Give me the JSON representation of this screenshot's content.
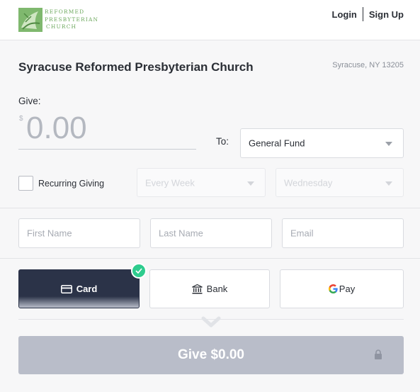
{
  "header": {
    "logo_lines": [
      "REFORMED",
      "PRESBYTERIAN",
      "CHURCH"
    ],
    "login_label": "Login",
    "signup_label": "Sign Up"
  },
  "church": {
    "name": "Syracuse Reformed Presbyterian Church",
    "location": "Syracuse, NY 13205"
  },
  "give": {
    "label": "Give:",
    "currency_symbol": "$",
    "amount_value": "0.00",
    "to_label": "To:",
    "fund_selected": "General Fund"
  },
  "recurring": {
    "label": "Recurring Giving",
    "checked": false,
    "frequency_selected": "Every Week",
    "day_selected": "Wednesday"
  },
  "donor": {
    "first_name_placeholder": "First Name",
    "last_name_placeholder": "Last Name",
    "email_placeholder": "Email"
  },
  "payment_methods": {
    "card_label": "Card",
    "bank_label": "Bank",
    "gpay_label": "Pay",
    "selected": "Card"
  },
  "submit": {
    "label": "Give $0.00"
  },
  "colors": {
    "accent_dark": "#2b3348",
    "success": "#2ecc8e",
    "logo_green": "#6ca85c",
    "button_disabled": "#b9bdc9"
  },
  "icons": [
    "logo-icon",
    "chevron-down-icon",
    "card-icon",
    "bank-icon",
    "google-g-icon",
    "check-icon",
    "lock-icon"
  ]
}
